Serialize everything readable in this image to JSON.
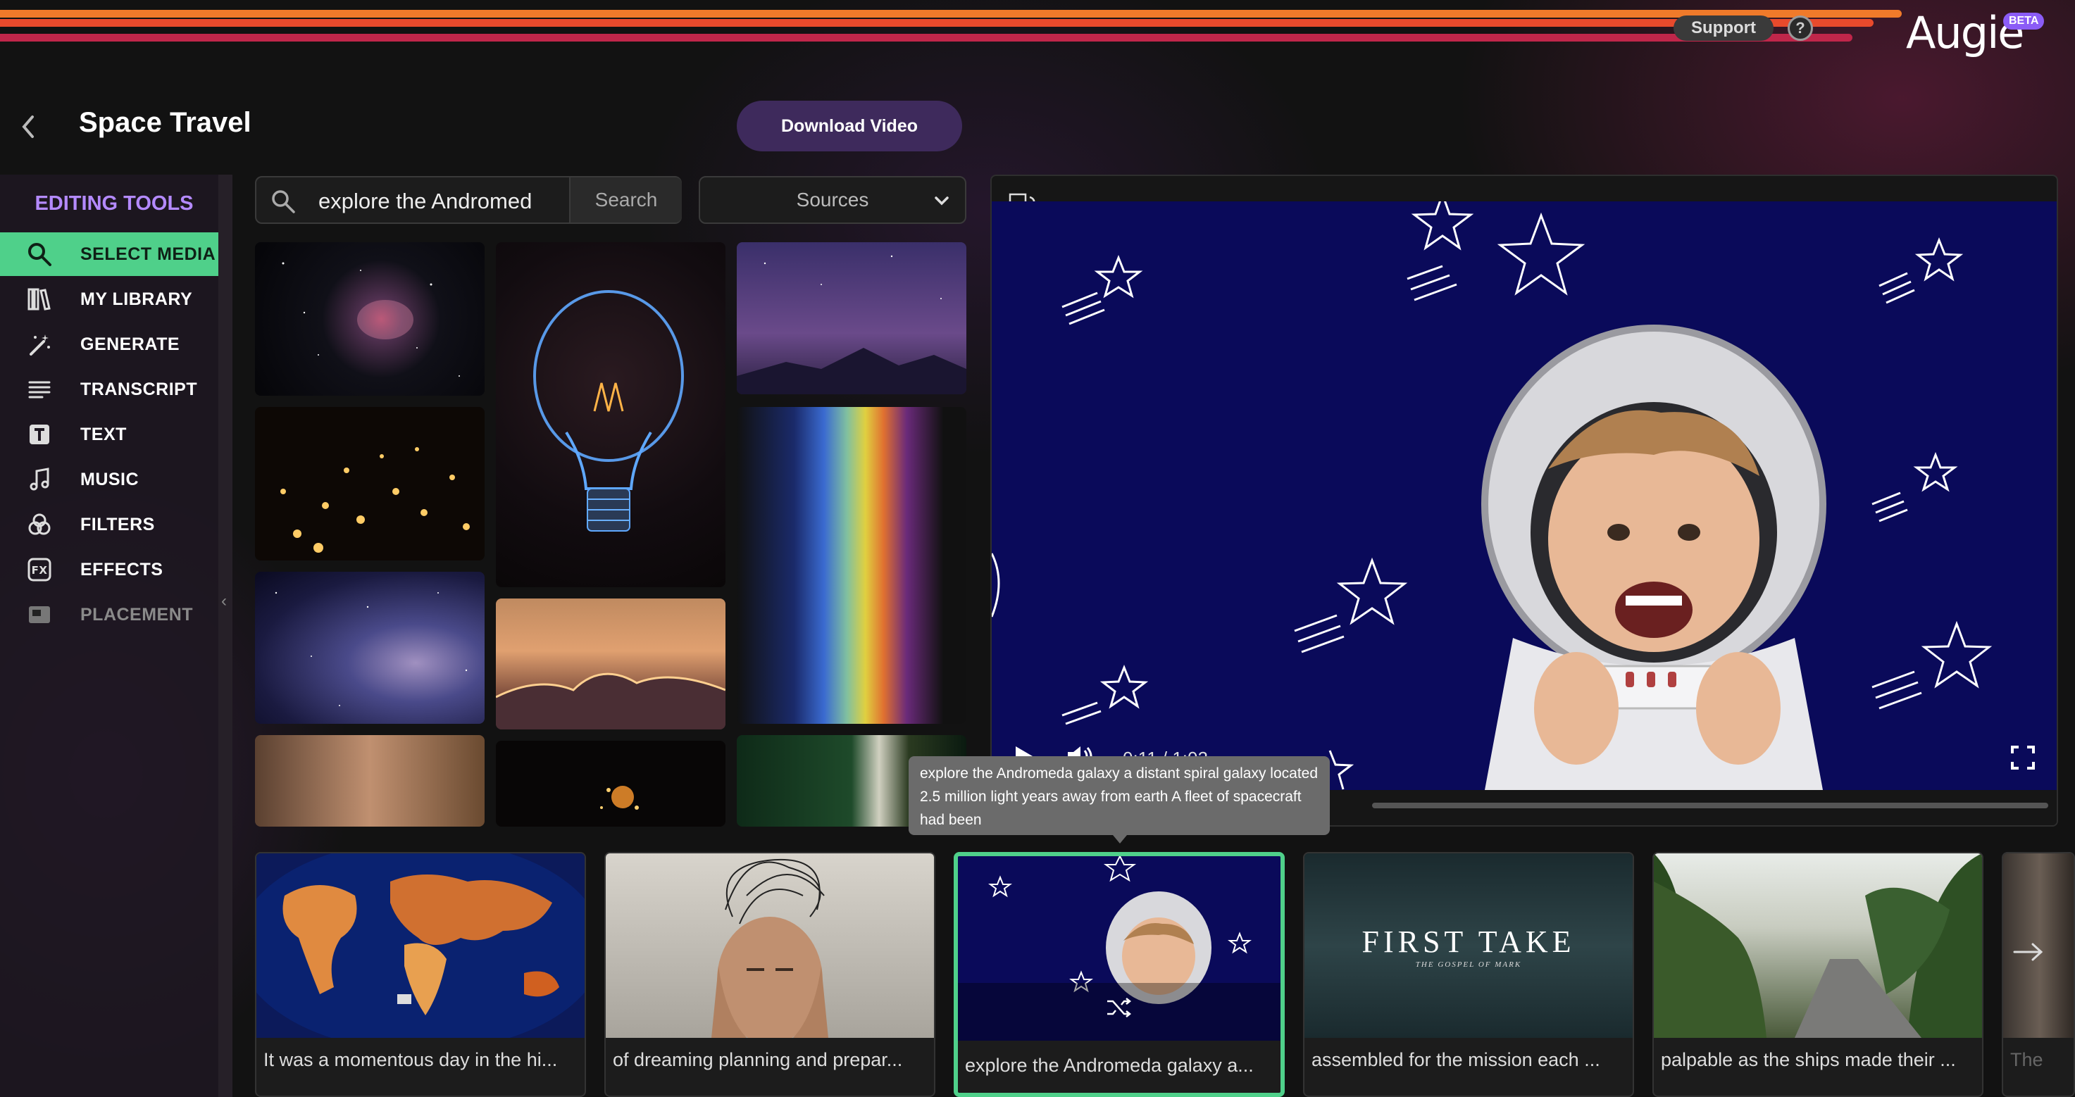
{
  "header": {
    "support_label": "Support",
    "help_label": "?",
    "logo_text": "Augie",
    "beta_label": "BETA",
    "stripe_colors": [
      "#f07a2a",
      "#e84a2c",
      "#c0264a"
    ]
  },
  "project": {
    "title": "Space Travel",
    "download_label": "Download Video"
  },
  "sidebar": {
    "heading": "EDITING TOOLS",
    "items": [
      {
        "label": "SELECT MEDIA",
        "icon": "search-icon",
        "state": "active"
      },
      {
        "label": "MY LIBRARY",
        "icon": "library-icon",
        "state": "normal"
      },
      {
        "label": "GENERATE",
        "icon": "magic-wand-icon",
        "state": "normal"
      },
      {
        "label": "TRANSCRIPT",
        "icon": "lines-icon",
        "state": "normal"
      },
      {
        "label": "TEXT",
        "icon": "text-icon",
        "state": "normal"
      },
      {
        "label": "MUSIC",
        "icon": "music-note-icon",
        "state": "normal"
      },
      {
        "label": "FILTERS",
        "icon": "filters-icon",
        "state": "normal"
      },
      {
        "label": "EFFECTS",
        "icon": "fx-icon",
        "state": "normal"
      },
      {
        "label": "PLACEMENT",
        "icon": "placement-icon",
        "state": "disabled"
      }
    ],
    "accent_color": "#4fd08a"
  },
  "media_search": {
    "query": "explore the Andromed",
    "search_label": "Search",
    "sources_label": "Sources"
  },
  "media_grid": [
    {
      "name": "orion-nebula"
    },
    {
      "name": "light-bulb"
    },
    {
      "name": "mountain-starry-sky"
    },
    {
      "name": "candles"
    },
    {
      "name": "rainbow-light"
    },
    {
      "name": "milky-way"
    },
    {
      "name": "sunset-clouds"
    },
    {
      "name": "blurry-warm-light"
    },
    {
      "name": "sparks"
    },
    {
      "name": "green-bokeh"
    }
  ],
  "player": {
    "time_display": "0:11 / 1:02"
  },
  "tooltip": {
    "text": "explore the Andromeda galaxy a distant spiral galaxy located 2.5 million light years away from earth A fleet of spacecraft had been"
  },
  "timeline": {
    "clips": [
      {
        "caption": "It was a momentous day in the hi...",
        "selected": false
      },
      {
        "caption": "of dreaming planning and prepar...",
        "selected": false
      },
      {
        "caption": "explore the Andromeda galaxy a...",
        "selected": true
      },
      {
        "caption": "assembled for the mission each ...",
        "selected": false
      },
      {
        "caption": "palpable as the ships made their ...",
        "selected": false
      }
    ],
    "partial_caption": "The",
    "first_take_title": "FIRST TAKE",
    "first_take_subtitle": "THE GOSPEL OF MARK"
  }
}
